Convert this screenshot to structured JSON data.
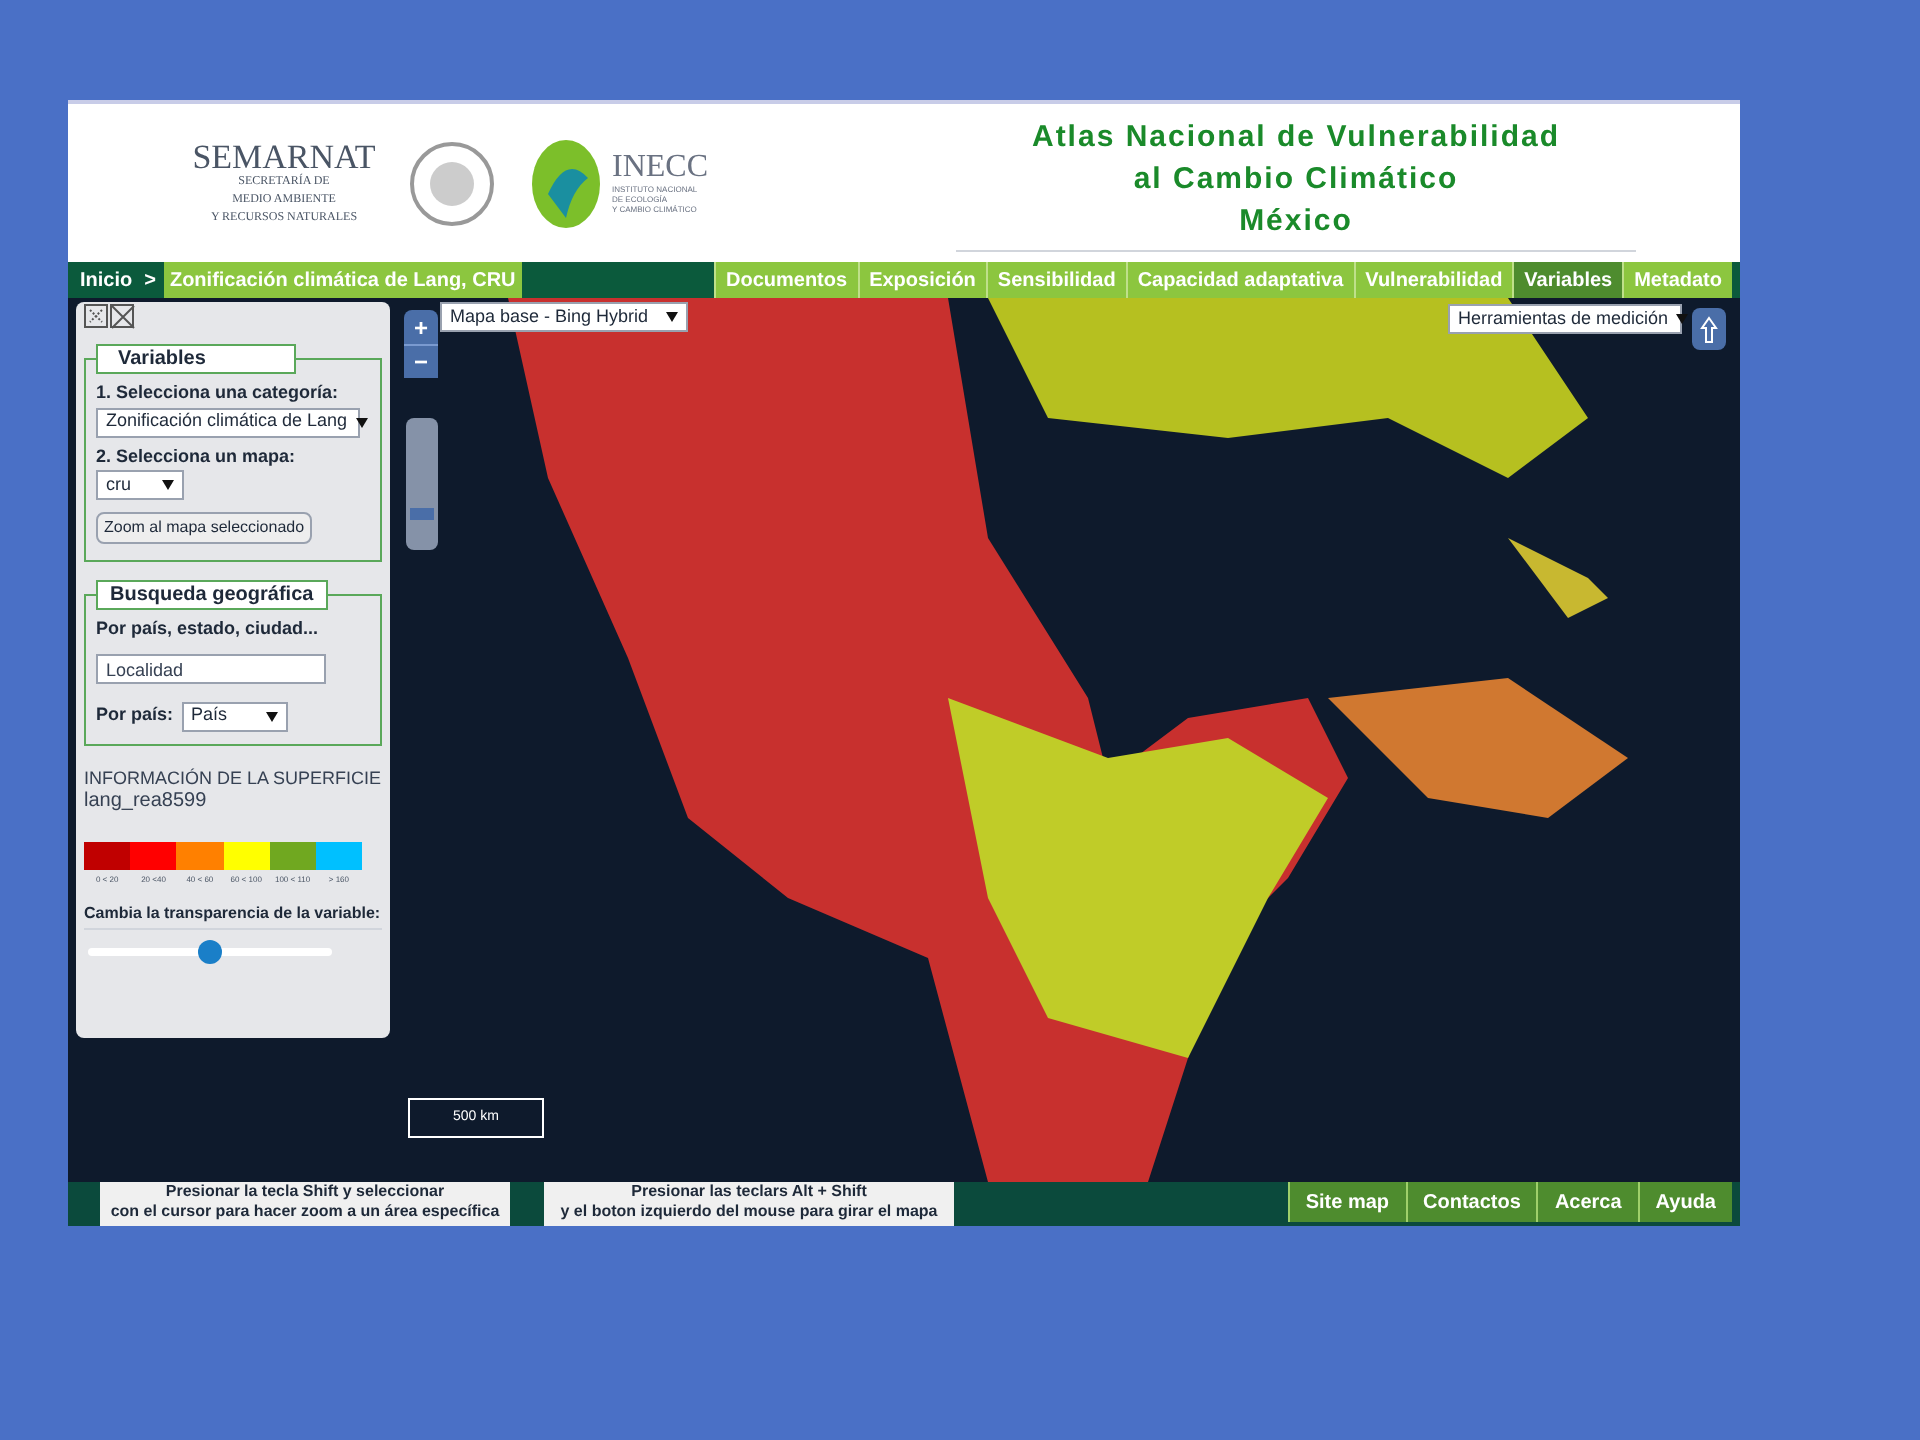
{
  "header": {
    "logo_1": {
      "name": "SEMARNAT",
      "lines": [
        "SECRETARÍA DE",
        "MEDIO AMBIENTE",
        "Y RECURSOS NATURALES"
      ]
    },
    "logo_2": {
      "name": "INECC",
      "lines": [
        "INSTITUTO NACIONAL",
        "DE ECOLOGÍA",
        "Y CAMBIO CLIMÁTICO"
      ]
    },
    "title_lines": [
      "Atlas Nacional de Vulnerabilidad",
      "al Cambio Climático",
      "México"
    ]
  },
  "breadcrumb": [
    "Inicio",
    ">",
    "Zonificación climática de Lang, CRU"
  ],
  "nav_tabs": [
    {
      "label": "Documentos",
      "selected": false
    },
    {
      "label": "Exposición",
      "selected": false
    },
    {
      "label": "Sensibilidad",
      "selected": false
    },
    {
      "label": "Capacidad adaptativa",
      "selected": false
    },
    {
      "label": "Vulnerabilidad",
      "selected": false
    },
    {
      "label": "Variables",
      "selected": true
    },
    {
      "label": "Metadato",
      "selected": false
    }
  ],
  "panel": {
    "variables": {
      "legend": "Variables",
      "category_label": "1. Selecciona una categoría:",
      "category_value": "Zonificación climática de Lang",
      "map_label": "2. Selecciona un mapa:",
      "map_value": "cru",
      "zoom_button": "Zoom al mapa seleccionado"
    },
    "search": {
      "legend": "Busqueda geográfica",
      "field_label": "Por país, estado, ciudad...",
      "field_value": "Localidad",
      "country_label": "Por país:",
      "country_value": "País"
    },
    "info_title": "INFORMACIÓN DE LA SUPERFICIE",
    "info_layer": "lang_rea8599",
    "legend_items": [
      {
        "label": "0 < 20",
        "color": "#c00000"
      },
      {
        "label": "20 <40",
        "color": "#ff0000"
      },
      {
        "label": "40 < 60",
        "color": "#ff8000"
      },
      {
        "label": "60 < 100",
        "color": "#ffff00"
      },
      {
        "label": "100 < 110",
        "color": "#70a820"
      },
      {
        "label": "> 160",
        "color": "#00c0ff"
      }
    ],
    "transparency_label": "Cambia la transparencia de la variable:",
    "transparency": {
      "level": 0.5
    }
  },
  "map": {
    "zoom_in": "+",
    "zoom_out": "−",
    "zoom_slider": {
      "level": 0.25
    },
    "base_layer": "Mapa base - Bing Hybrid",
    "tools": "Herramientas de medición",
    "scale": "500 km"
  },
  "footer": {
    "hints": [
      [
        "Presionar la tecla Shift y seleccionar",
        "con el cursor para hacer zoom a un área específica"
      ],
      [
        "Presionar las teclars Alt + Shift",
        "y el boton izquierdo del mouse para girar el mapa"
      ]
    ],
    "links": [
      "Site map",
      "Contactos",
      "Acerca",
      "Ayuda"
    ]
  }
}
